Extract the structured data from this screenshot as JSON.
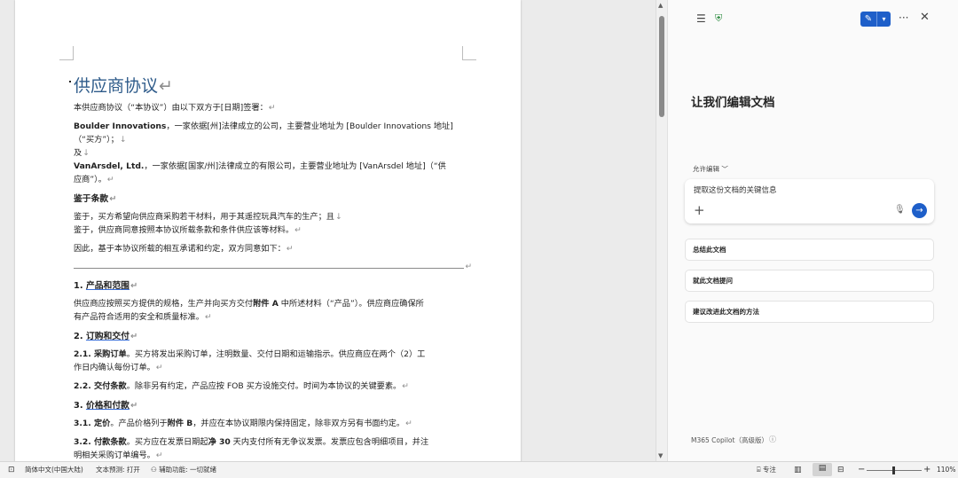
{
  "document": {
    "title": "供应商协议",
    "intro": "本供应商协议（“本协议”）由以下双方于[日期]签署：",
    "buyer_name": "Boulder Innovations",
    "buyer_rest_1": "，一家依据[州]法律成立的公司，主要营业地址为 [Boulder Innovations 地址]",
    "buyer_rest_2": "（“买方”）；",
    "and": "及",
    "seller_name": "VanArsdel, Ltd.",
    "seller_rest_1": "，一家依据[国家/州]法律成立的有限公司，主要营业地址为 [VanArsdel 地址]（“供",
    "seller_rest_2": "应商”）。",
    "recitals_heading": "鉴于条款",
    "recital_1": "鉴于，买方希望向供应商采购若干材料，用于其遥控玩具汽车的生产；且",
    "recital_2": "鉴于，供应商同意按照本协议所载条款和条件供应该等材料。",
    "therefore": "因此，基于本协议所载的相互承诺和约定，双方同意如下：",
    "sec1_num": "1. ",
    "sec1_title": "产品和范围",
    "sec1_p1_a": "供应商应按照买方提供的规格，生产并向买方交付",
    "sec1_p1_bold": "附件 A",
    "sec1_p1_b": " 中所述材料（“产品”）。供应商应确保所",
    "sec1_p1_c": "有产品符合适用的安全和质量标准。",
    "sec2_num": "2. ",
    "sec2_title": "订购和交付",
    "sec2_1_label": "2.1. 采购订单",
    "sec2_1_a": "。买方将发出采购订单，注明数量、交付日期和运输指示。供应商应在两个（2）工",
    "sec2_1_b": "作日内确认每份订单。",
    "sec2_2_label": "2.2. 交付条款",
    "sec2_2_text": "。除非另有约定，产品应按 FOB 买方设施交付。时间为本协议的关键要素。",
    "sec3_num": "3. ",
    "sec3_title": "价格和付款",
    "sec3_1_label": "3.1. 定价",
    "sec3_1_a": "。产品价格列于",
    "sec3_1_bold": "附件 B",
    "sec3_1_b": "，并应在本协议期限内保持固定，除非双方另有书面约定。",
    "sec3_2_label": "3.2. 付款条款",
    "sec3_2_a": "。买方应在发票日期起",
    "sec3_2_bold": "净 30",
    "sec3_2_b": " 天内支付所有无争议发票。发票应包含明细项目，并注",
    "sec3_2_c": "明相关采购订单编号。",
    "para_mark": "↵",
    "line_break_mark": "↓"
  },
  "panel": {
    "icons": {
      "menu": "menu-icon",
      "shield": "shield-check-icon",
      "new_chat": "compose-icon",
      "chevron": "chevron-down-icon",
      "more": "more-icon",
      "close": "close-icon"
    },
    "title": "让我们编辑文档",
    "allow_edit_label": "允许编辑 ﹀",
    "prompt_text": "提取这份文档的关键信息",
    "suggestions": [
      "总结此文档",
      "就此文档提问",
      "建议改进此文档的方法"
    ],
    "model_label": "M365 Copilot（高级版）",
    "accent_color": "#1e5fc9"
  },
  "statusbar": {
    "language": "简体中文(中国大陆)",
    "text_prediction": "文本预测: 打开",
    "accessibility": "辅助功能: 一切就绪",
    "focus": "专注",
    "zoom": "110%"
  }
}
